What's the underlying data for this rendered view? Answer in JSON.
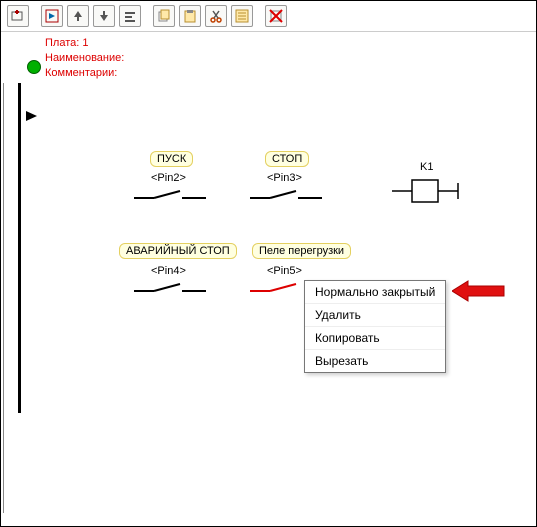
{
  "header": {
    "plata_label": "Плата:",
    "plata_value": "1",
    "name_label": "Наименование:",
    "comment_label": "Комментарии:"
  },
  "toolbar": {
    "icons": [
      "box-plus",
      "flag-in",
      "arrow-up",
      "arrow-down",
      "align",
      "multi-page",
      "paste",
      "cut",
      "list",
      "no-box"
    ]
  },
  "schematic": {
    "tags": {
      "pusk": "ПУСК",
      "stop": "СТОП",
      "avar": "АВАРИЙНЫЙ СТОП",
      "overload": "Пеле перегрузки"
    },
    "pins": {
      "pin2": "<Pin2>",
      "pin3": "<Pin3>",
      "pin4": "<Pin4>",
      "pin5": "<Pin5>"
    },
    "relay": "K1"
  },
  "context_menu": {
    "items": [
      "Нормально закрытый",
      "Удалить",
      "Копировать",
      "Вырезать"
    ],
    "selected_index": 0
  }
}
